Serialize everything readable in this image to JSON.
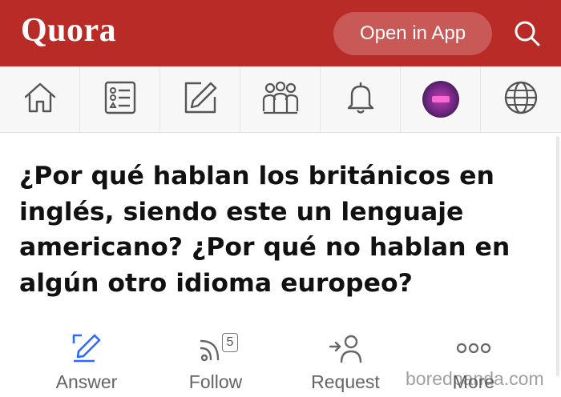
{
  "header": {
    "logo_text": "Quora",
    "open_app_label": "Open in App",
    "brand_color": "#b92b27",
    "search_icon": "search-icon"
  },
  "nav": {
    "items": [
      {
        "name": "home",
        "icon": "home-icon"
      },
      {
        "name": "following",
        "icon": "feed-list-icon"
      },
      {
        "name": "write",
        "icon": "pencil-square-icon"
      },
      {
        "name": "spaces",
        "icon": "people-group-icon"
      },
      {
        "name": "notifications",
        "icon": "bell-icon"
      },
      {
        "name": "profile",
        "icon": "avatar"
      },
      {
        "name": "language",
        "icon": "globe-icon"
      }
    ]
  },
  "question": {
    "text": "¿Por qué hablan los británicos en inglés, siendo este un lenguaje americano? ¿Por qué no hablan en algún otro idioma europeo?"
  },
  "actions": {
    "answer_label": "Answer",
    "follow_label": "Follow",
    "follow_count": "5",
    "request_label": "Request",
    "more_label": "More",
    "accent_color": "#2e69ff"
  },
  "watermark": {
    "text": "boredpanda.com"
  }
}
